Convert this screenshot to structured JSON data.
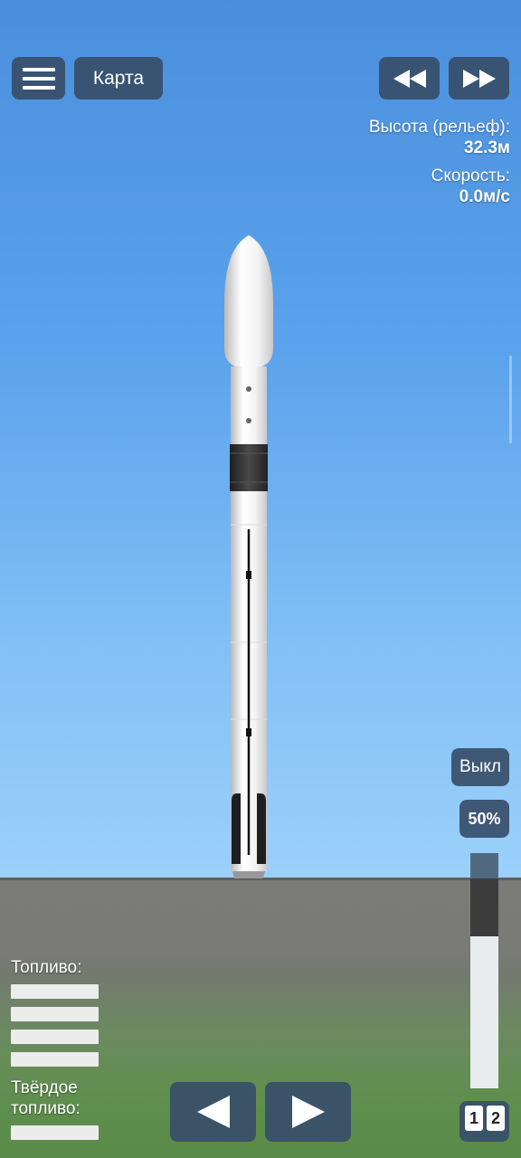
{
  "toolbar": {
    "menu_icon": "hamburger-menu-icon",
    "map_label": "Карта",
    "rewind_icon": "rewind-icon",
    "fast_forward_icon": "fast-forward-icon"
  },
  "telemetry": {
    "altitude_label": "Высота (рельеф):",
    "altitude_value": "32.3м",
    "speed_label": "Скорость:",
    "speed_value": "0.0м/с"
  },
  "controls": {
    "engine_toggle_label": "Выкл",
    "throttle_label": "50%",
    "throttle_level": 0.5,
    "left_icon": "triangle-left-icon",
    "right_icon": "triangle-right-icon"
  },
  "fuel": {
    "liquid_label": "Топливо:",
    "solid_label_line1": "Твёрдое",
    "solid_label_line2": "топливо:"
  },
  "stages": [
    "1",
    "2"
  ],
  "colors": {
    "button_bg": "#374e69",
    "sky_top": "#4a8fdc",
    "sky_bottom": "#9bd0fa",
    "ground": "#7b7b78"
  }
}
